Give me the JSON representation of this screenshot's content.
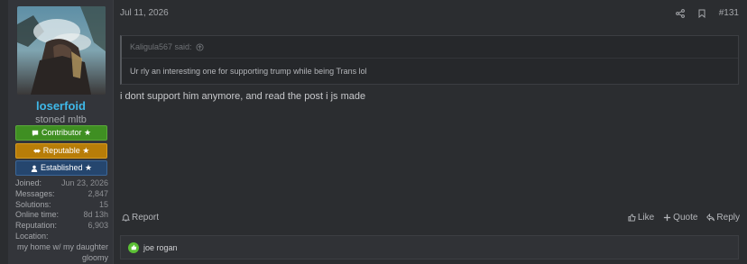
{
  "user": {
    "username": "loserfoid",
    "title": "stoned mltb",
    "badges": [
      {
        "label": "Contributor ★",
        "icon": "chat-icon",
        "color": "#3f8f22"
      },
      {
        "label": "Reputable ★",
        "icon": "handshake-icon",
        "color": "#b87d08"
      },
      {
        "label": "Established ★",
        "icon": "user-icon",
        "color": "#25466e"
      }
    ],
    "stats": [
      {
        "label": "Joined:",
        "value": "Jun 23, 2026"
      },
      {
        "label": "Messages:",
        "value": "2,847"
      },
      {
        "label": "Solutions:",
        "value": "15"
      },
      {
        "label": "Online time:",
        "value": "8d 13h"
      },
      {
        "label": "Reputation:",
        "value": "6,903"
      }
    ],
    "location_label": "Location:",
    "location_value": "my home w/ my daughter gloomy"
  },
  "post": {
    "date": "Jul 11, 2026",
    "number": "#131",
    "quote_author": "Kaligula567 said:",
    "quote_text": "Ur rly an interesting one for supporting trump while being Trans lol",
    "message": "i dont support him anymore, and read the post i js made"
  },
  "actions": {
    "report": "Report",
    "like": "Like",
    "quote": "Quote",
    "reply": "Reply"
  },
  "reactions": {
    "text": "joe rogan"
  }
}
